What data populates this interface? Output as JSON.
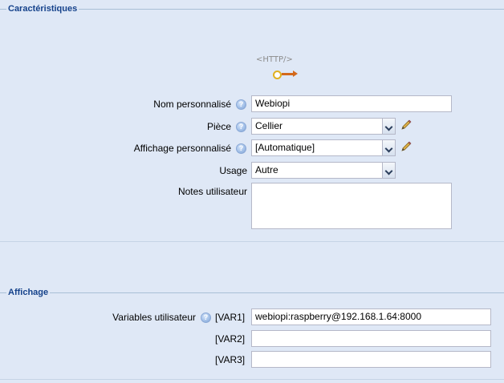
{
  "sections": {
    "characteristics_title": "Caractéristiques",
    "display_title": "Affichage"
  },
  "device_icon": {
    "text": "<HTTP/>"
  },
  "form": {
    "name_label": "Nom personnalisé",
    "name_value": "Webiopi",
    "room_label": "Pièce",
    "room_value": "Cellier",
    "display_label": "Affichage personnalisé",
    "display_value": "[Automatique]",
    "usage_label": "Usage",
    "usage_value": "Autre",
    "notes_label": "Notes utilisateur",
    "notes_value": ""
  },
  "variables": {
    "label": "Variables utilisateur",
    "items": [
      {
        "key": "[VAR1]",
        "value": "webiopi:raspberry@192.168.1.64:8000"
      },
      {
        "key": "[VAR2]",
        "value": ""
      },
      {
        "key": "[VAR3]",
        "value": ""
      }
    ]
  },
  "colors": {
    "background": "#dfe8f6",
    "legend": "#15428b",
    "arrow": "#d3691c"
  }
}
